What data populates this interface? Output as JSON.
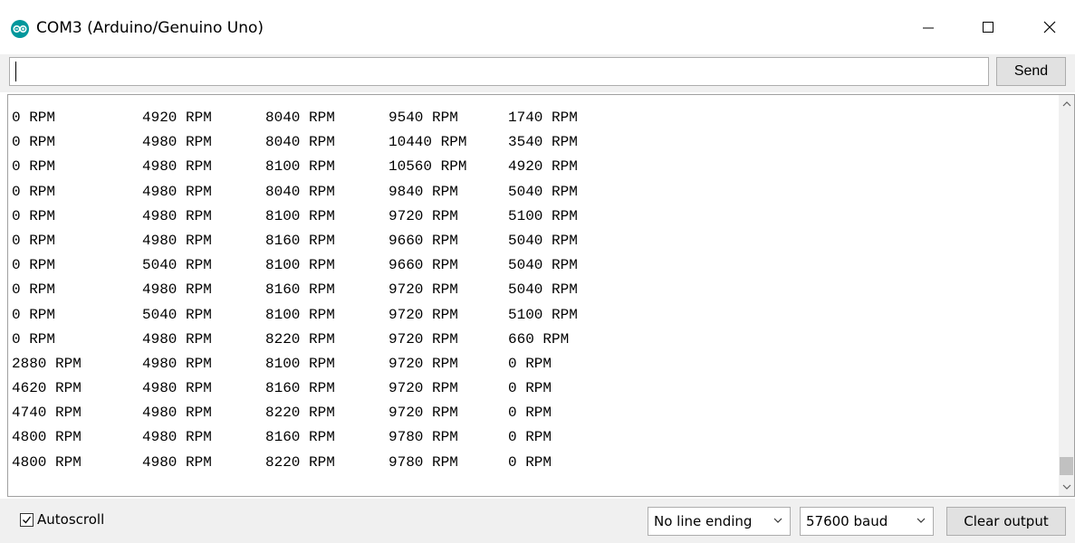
{
  "window": {
    "title": "COM3 (Arduino/Genuino Uno)",
    "app_icon": "arduino-logo-icon",
    "controls": [
      "minimize-icon",
      "maximize-icon",
      "close-icon"
    ]
  },
  "send_row": {
    "input_value": "",
    "send_label": "Send"
  },
  "output": {
    "lines": [
      [
        "0 RPM",
        "4920 RPM",
        "8040 RPM",
        "9540 RPM",
        "1740 RPM"
      ],
      [
        "0 RPM",
        "4980 RPM",
        "8040 RPM",
        "10440 RPM",
        "3540 RPM"
      ],
      [
        "0 RPM",
        "4980 RPM",
        "8100 RPM",
        "10560 RPM",
        "4920 RPM"
      ],
      [
        "0 RPM",
        "4980 RPM",
        "8040 RPM",
        "9840 RPM",
        "5040 RPM"
      ],
      [
        "0 RPM",
        "4980 RPM",
        "8100 RPM",
        "9720 RPM",
        "5100 RPM"
      ],
      [
        "0 RPM",
        "4980 RPM",
        "8160 RPM",
        "9660 RPM",
        "5040 RPM"
      ],
      [
        "0 RPM",
        "5040 RPM",
        "8100 RPM",
        "9660 RPM",
        "5040 RPM"
      ],
      [
        "0 RPM",
        "4980 RPM",
        "8160 RPM",
        "9720 RPM",
        "5040 RPM"
      ],
      [
        "0 RPM",
        "5040 RPM",
        "8100 RPM",
        "9720 RPM",
        "5100 RPM"
      ],
      [
        "0 RPM",
        "4980 RPM",
        "8220 RPM",
        "9720 RPM",
        "660 RPM"
      ],
      [
        "2880 RPM",
        "4980 RPM",
        "8100 RPM",
        "9720 RPM",
        "0 RPM"
      ],
      [
        "4620 RPM",
        "4980 RPM",
        "8160 RPM",
        "9720 RPM",
        "0 RPM"
      ],
      [
        "4740 RPM",
        "4980 RPM",
        "8220 RPM",
        "9720 RPM",
        "0 RPM"
      ],
      [
        "4800 RPM",
        "4980 RPM",
        "8160 RPM",
        "9780 RPM",
        "0 RPM"
      ],
      [
        "4800 RPM",
        "4980 RPM",
        "8220 RPM",
        "9780 RPM",
        "0 RPM"
      ]
    ]
  },
  "bottom_bar": {
    "autoscroll_label": "Autoscroll",
    "autoscroll_checked": true,
    "line_ending_selected": "No line ending",
    "baud_selected": "57600 baud",
    "clear_label": "Clear output"
  }
}
